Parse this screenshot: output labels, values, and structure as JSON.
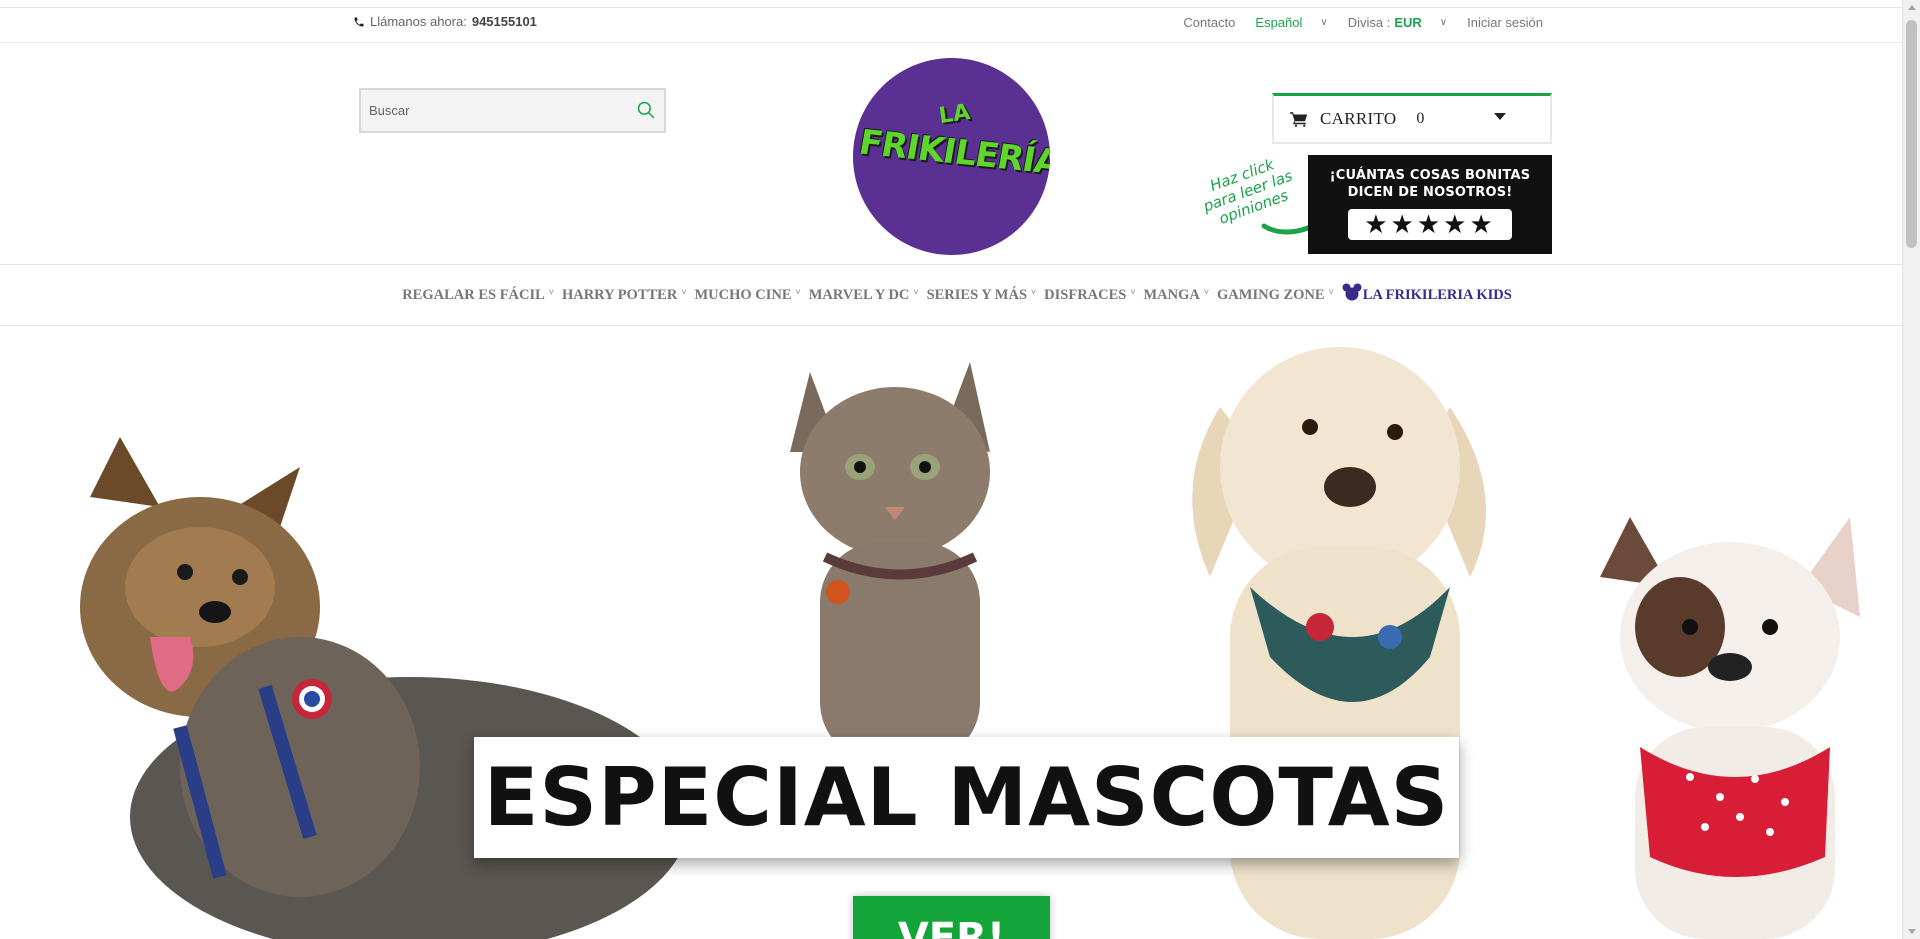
{
  "topbar": {
    "phone_prefix": "Llámanos ahora:",
    "phone_number": "945155101",
    "contact": "Contacto",
    "language": "Español",
    "currency_label": "Divisa :",
    "currency_value": "EUR",
    "login": "Iniciar sesión"
  },
  "header": {
    "search_placeholder": "Buscar",
    "logo_top": "LA",
    "logo_main": "FRIKILERÍA",
    "cart_label": "CARRITO",
    "cart_count": "0",
    "reviews_note": "Haz click para leer las opiniones",
    "reviews_title": "¡CUÁNTAS COSAS BONITAS DICEN DE NOSOTROS!",
    "reviews_stars": "★★★★★"
  },
  "nav": {
    "items": [
      {
        "label": "REGALAR ES FÁCIL"
      },
      {
        "label": "HARRY POTTER"
      },
      {
        "label": "MUCHO CINE"
      },
      {
        "label": "MARVEL Y DC"
      },
      {
        "label": "SERIES Y MÁS"
      },
      {
        "label": "DISFRACES"
      },
      {
        "label": "MANGA"
      },
      {
        "label": "GAMING ZONE"
      }
    ],
    "kids_label": "LA FRIKILERIA KIDS",
    "dropdown_glyph": "˅"
  },
  "hero": {
    "banner_title": "ESPECIAL MASCOTAS",
    "cta_label": "VER!"
  },
  "colors": {
    "accent_green": "#1aa34a",
    "logo_purple": "#5a3092",
    "kids_blue": "#3b2a8c",
    "cta_green": "#14a53a"
  }
}
